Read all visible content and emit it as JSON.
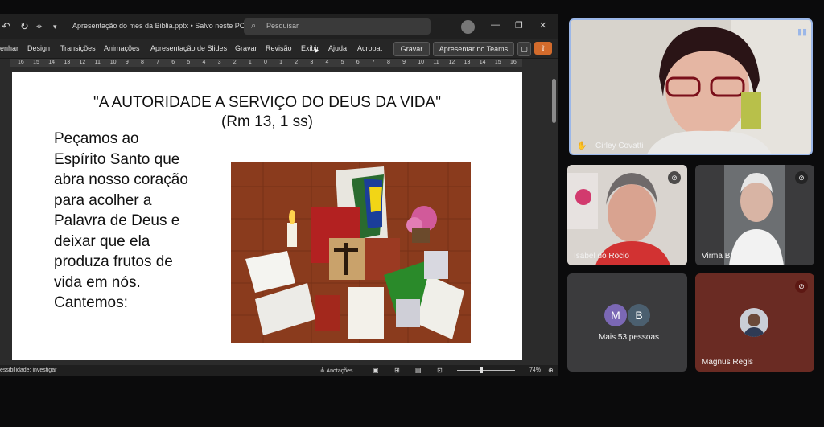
{
  "ppt": {
    "doc_title": "Apresentação do mes da Biblia.pptx • Salvo neste PC ⌄",
    "search_placeholder": "Pesquisar",
    "tabs": [
      "enhar",
      "Design",
      "Transições",
      "Animações",
      "Apresentação de Slides",
      "Gravar",
      "Revisão",
      "Exibir",
      "Ajuda",
      "Acrobat"
    ],
    "btn_gravar": "Gravar",
    "btn_teams": "Apresentar no Teams",
    "ruler": [
      "16",
      "15",
      "14",
      "13",
      "12",
      "11",
      "10",
      "9",
      "8",
      "7",
      "6",
      "5",
      "4",
      "3",
      "2",
      "1",
      "0",
      "1",
      "2",
      "3",
      "4",
      "5",
      "6",
      "7",
      "8",
      "9",
      "10",
      "11",
      "12",
      "13",
      "14",
      "15",
      "16"
    ],
    "status_left": "essibilidade: investigar",
    "status_notes": "≜ Anotações",
    "zoom": "74%"
  },
  "slide": {
    "title": "\"A AUTORIDADE A SERVIÇO DO DEUS DA VIDA\"",
    "subtitle": "(Rm 13, 1 ss)",
    "lines": [
      "Peçamos ao",
      "Espírito Santo que",
      "abra nosso coração",
      "para acolher a",
      "Palavra de Deus e",
      "deixar que ela",
      "produza frutos de",
      "vida em nós.",
      "Cantemos:"
    ]
  },
  "teams": {
    "participants": [
      {
        "name": "Cirley Covatti",
        "speaking": true
      },
      {
        "name": "Isabel do Rocio",
        "muted": true
      },
      {
        "name": "Virma Barion",
        "muted": true
      },
      {
        "name": "Magnus Regis",
        "muted": true
      }
    ],
    "more": {
      "initials": [
        "M",
        "B"
      ],
      "label": "Mais 53 pessoas"
    }
  },
  "colors": {
    "accent": "#9bb7e8",
    "share": "#d36b2c",
    "tile": "#3b3b3d"
  }
}
